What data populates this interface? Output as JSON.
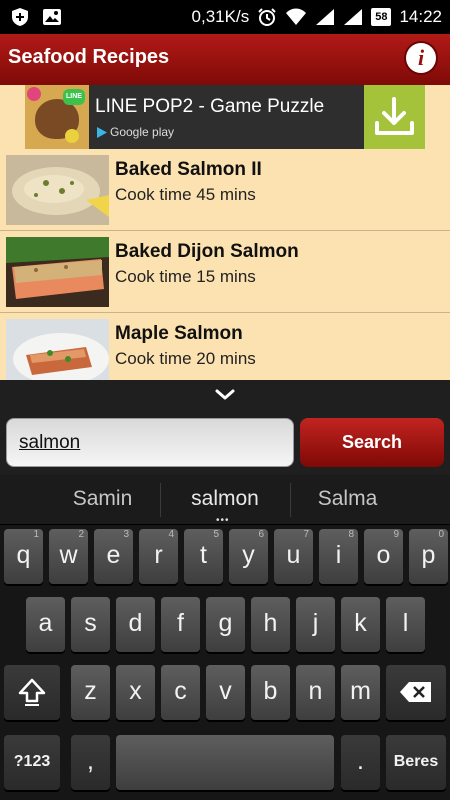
{
  "status_bar": {
    "speed": "0,31K/s",
    "battery": "58",
    "time": "14:22"
  },
  "app": {
    "title": "Seafood Recipes",
    "info_label": "i"
  },
  "ad": {
    "title": "LINE POP2 - Game Puzzle",
    "store": "Google play",
    "logo_text": "LINE"
  },
  "recipes": [
    {
      "name": "Baked Salmon II",
      "time": "Cook time 45 mins"
    },
    {
      "name": "Baked Dijon Salmon",
      "time": "Cook time 15 mins"
    },
    {
      "name": "Maple Salmon",
      "time": "Cook time 20 mins"
    }
  ],
  "search": {
    "value": "salmon",
    "button_label": "Search"
  },
  "keyboard": {
    "suggestions": [
      "Samin",
      "salmon",
      "Salma"
    ],
    "suggest_more": "•••",
    "row1": [
      {
        "key": "q",
        "hint": "1"
      },
      {
        "key": "w",
        "hint": "2"
      },
      {
        "key": "e",
        "hint": "3"
      },
      {
        "key": "r",
        "hint": "4"
      },
      {
        "key": "t",
        "hint": "5"
      },
      {
        "key": "y",
        "hint": "6"
      },
      {
        "key": "u",
        "hint": "7"
      },
      {
        "key": "i",
        "hint": "8"
      },
      {
        "key": "o",
        "hint": "9"
      },
      {
        "key": "p",
        "hint": "0"
      }
    ],
    "row2": [
      "a",
      "s",
      "d",
      "f",
      "g",
      "h",
      "j",
      "k",
      "l"
    ],
    "row3": [
      "z",
      "x",
      "c",
      "v",
      "b",
      "n",
      "m"
    ],
    "symbols_label": "?123",
    "comma_label": ",",
    "period_label": ".",
    "enter_label": "Beres",
    "shift_icon": "shift-icon",
    "delete_icon": "backspace-icon"
  },
  "colors": {
    "app_bar": "#9c0d0a",
    "list_bg": "#fbe2b0",
    "ad_download": "#a4c23a"
  }
}
